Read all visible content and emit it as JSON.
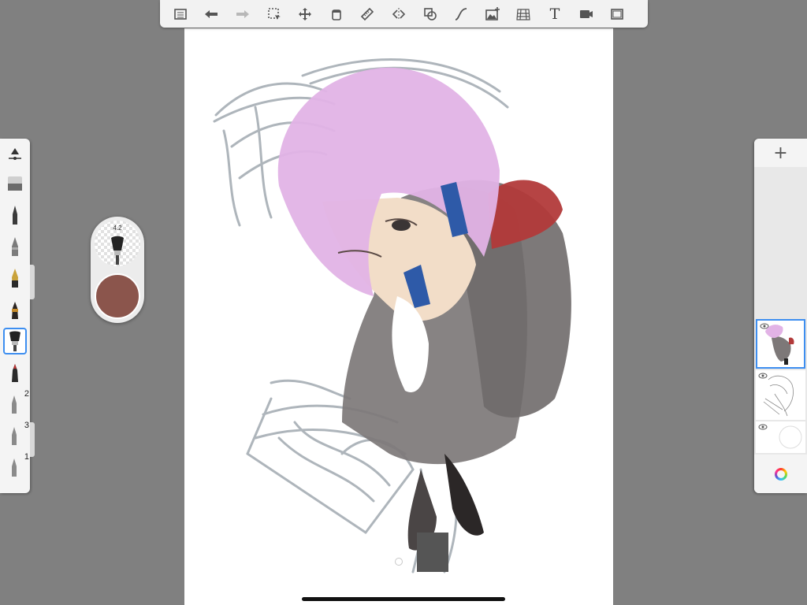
{
  "app": {
    "name": ""
  },
  "top_toolbar": {
    "tools": [
      {
        "id": "menu",
        "icon": "menu-list-icon"
      },
      {
        "id": "undo",
        "icon": "undo-arrow-icon"
      },
      {
        "id": "redo",
        "icon": "redo-arrow-icon"
      },
      {
        "id": "selection",
        "icon": "selection-tool-icon"
      },
      {
        "id": "transform",
        "icon": "move-arrows-icon"
      },
      {
        "id": "fill",
        "icon": "paint-bucket-icon"
      },
      {
        "id": "ruler",
        "icon": "ruler-icon"
      },
      {
        "id": "symmetry",
        "icon": "symmetry-icon"
      },
      {
        "id": "shapes",
        "icon": "shapes-icon"
      },
      {
        "id": "stroke",
        "icon": "curve-stroke-icon"
      },
      {
        "id": "import-image",
        "icon": "image-add-icon"
      },
      {
        "id": "perspective",
        "icon": "perspective-grid-icon"
      },
      {
        "id": "text",
        "icon": "text-tool-icon",
        "label": "T"
      },
      {
        "id": "record",
        "icon": "video-camera-icon"
      },
      {
        "id": "fullscreen",
        "icon": "fullscreen-icon"
      }
    ]
  },
  "brush_palette": {
    "brushes": [
      {
        "name": "brush-settings",
        "number": ""
      },
      {
        "name": "eraser",
        "number": ""
      },
      {
        "name": "pencil",
        "number": ""
      },
      {
        "name": "ballpoint",
        "number": ""
      },
      {
        "name": "fountain-pen",
        "number": ""
      },
      {
        "name": "marker",
        "number": ""
      },
      {
        "name": "paint-brush",
        "number": "",
        "selected": true
      },
      {
        "name": "airbrush",
        "number": ""
      },
      {
        "name": "custom-brush-2",
        "number": "2"
      },
      {
        "name": "custom-brush-3",
        "number": "3"
      },
      {
        "name": "custom-brush-1",
        "number": "1"
      }
    ]
  },
  "brush_puck": {
    "size": "4.2",
    "color": "#8b554c"
  },
  "layers": {
    "add_label": "+",
    "items": [
      {
        "name": "color-layer",
        "active": true,
        "visible": true
      },
      {
        "name": "sketch-layer",
        "active": false,
        "visible": true
      },
      {
        "name": "background-layer",
        "active": false,
        "visible": true
      }
    ]
  },
  "colors": {
    "accent": "#3d8ef0",
    "hair": "#e2b3e6",
    "skin": "#f2ddc8",
    "sweater": "#7d7878",
    "bag": "#b23a3a",
    "pen": "#2e5aa8",
    "sketch": "#9aa3ab"
  }
}
